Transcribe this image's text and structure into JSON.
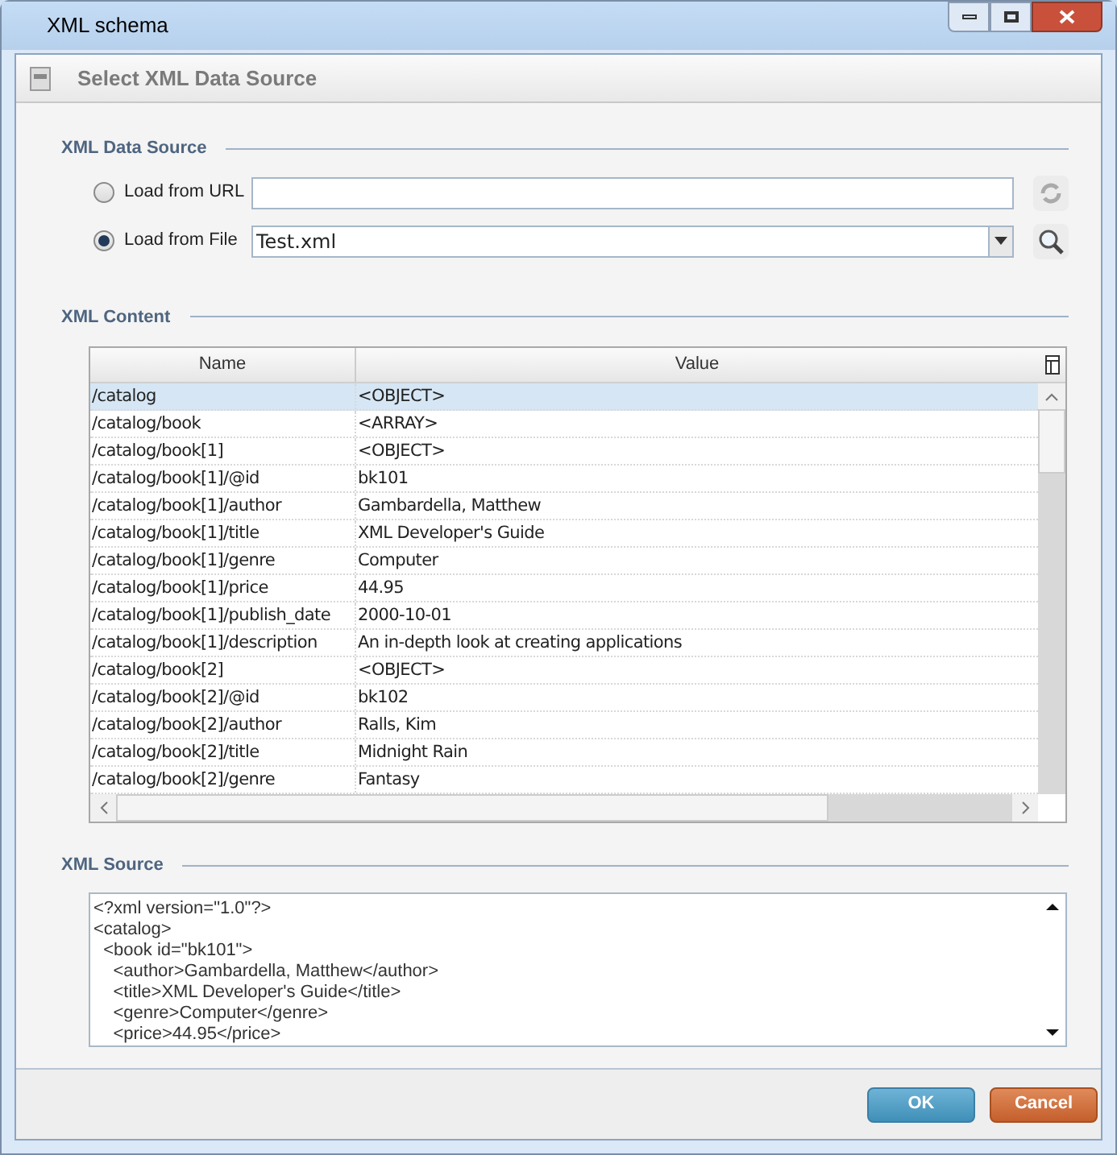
{
  "window": {
    "title": "XML schema"
  },
  "header": {
    "title": "Select XML Data Source"
  },
  "data_source": {
    "legend": "XML Data Source",
    "options": [
      {
        "label": "Load from URL",
        "selected": false,
        "kind": "url"
      },
      {
        "label": "Load from File",
        "selected": true,
        "kind": "file",
        "value": "Test.xml"
      }
    ]
  },
  "content": {
    "legend": "XML Content",
    "columns": [
      "Name",
      "Value"
    ],
    "rows": [
      {
        "name": "/catalog",
        "value": "<OBJECT>",
        "selected": true
      },
      {
        "name": "/catalog/book",
        "value": "<ARRAY>",
        "selected": false
      },
      {
        "name": "/catalog/book[1]",
        "value": "<OBJECT>",
        "selected": false
      },
      {
        "name": "/catalog/book[1]/@id",
        "value": "bk101",
        "selected": false
      },
      {
        "name": "/catalog/book[1]/author",
        "value": "Gambardella, Matthew",
        "selected": false
      },
      {
        "name": "/catalog/book[1]/title",
        "value": "XML Developer's Guide",
        "selected": false
      },
      {
        "name": "/catalog/book[1]/genre",
        "value": "Computer",
        "selected": false
      },
      {
        "name": "/catalog/book[1]/price",
        "value": "44.95",
        "selected": false
      },
      {
        "name": "/catalog/book[1]/publish_date",
        "value": "2000-10-01",
        "selected": false
      },
      {
        "name": "/catalog/book[1]/description",
        "value": "An in-depth look at creating applications",
        "selected": false
      },
      {
        "name": "/catalog/book[2]",
        "value": "<OBJECT>",
        "selected": false
      },
      {
        "name": "/catalog/book[2]/@id",
        "value": "bk102",
        "selected": false
      },
      {
        "name": "/catalog/book[2]/author",
        "value": "Ralls, Kim",
        "selected": false
      },
      {
        "name": "/catalog/book[2]/title",
        "value": "Midnight Rain",
        "selected": false
      },
      {
        "name": "/catalog/book[2]/genre",
        "value": "Fantasy",
        "selected": false
      }
    ]
  },
  "source": {
    "legend": "XML Source",
    "lines": [
      "<?xml version=\"1.0\"?>",
      "<catalog>",
      "  <book id=\"bk101\">",
      "    <author>Gambardella, Matthew</author>",
      "    <title>XML Developer's Guide</title>",
      "    <genre>Computer</genre>",
      "    <price>44.95</price>"
    ]
  },
  "buttons": [
    {
      "label": "OK",
      "kind": "primary"
    },
    {
      "label": "Cancel",
      "kind": "cancel"
    }
  ]
}
